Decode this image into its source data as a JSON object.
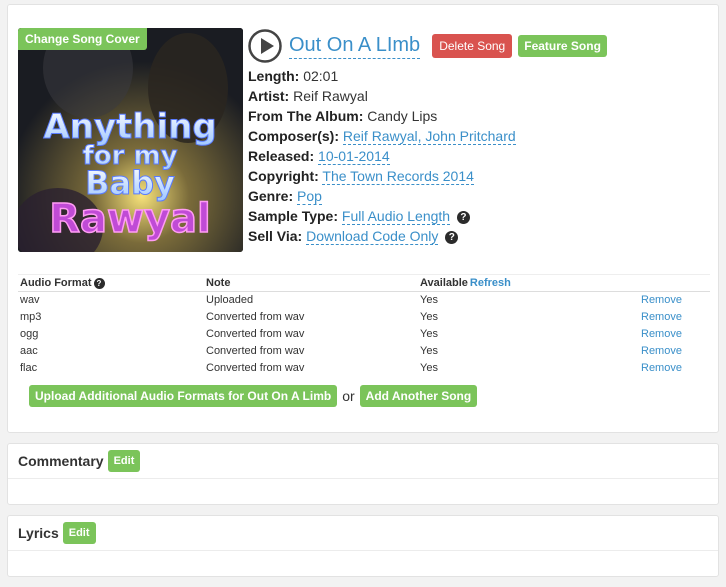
{
  "song": {
    "change_cover_label": "Change Song Cover",
    "title": "Out On A LImb",
    "delete_label": "Delete Song",
    "feature_label": "Feature Song",
    "cover_art": {
      "line1": "Anything",
      "line2": "for my",
      "line3": "Baby",
      "line4": "Rawyal"
    },
    "details": {
      "length_label": "Length:",
      "length_value": "02:01",
      "artist_label": "Artist:",
      "artist_value": "Reif Rawyal",
      "album_label": "From The Album:",
      "album_value": "Candy Lips",
      "composer_label": "Composer(s):",
      "composer_value": "Reif Rawyal, John Pritchard",
      "released_label": "Released:",
      "released_value": "10-01-2014",
      "copyright_label": "Copyright:",
      "copyright_value": "The Town Records 2014",
      "genre_label": "Genre:",
      "genre_value": "Pop",
      "sample_label": "Sample Type:",
      "sample_value": "Full Audio Length",
      "sell_label": "Sell Via:",
      "sell_value": "Download Code Only"
    }
  },
  "formats": {
    "headers": {
      "format": "Audio Format",
      "note": "Note",
      "available": "Available",
      "refresh": "Refresh"
    },
    "rows": [
      {
        "format": "wav",
        "note": "Uploaded",
        "available": "Yes",
        "action": "Remove"
      },
      {
        "format": "mp3",
        "note": "Converted from wav",
        "available": "Yes",
        "action": "Remove"
      },
      {
        "format": "ogg",
        "note": "Converted from wav",
        "available": "Yes",
        "action": "Remove"
      },
      {
        "format": "aac",
        "note": "Converted from wav",
        "available": "Yes",
        "action": "Remove"
      },
      {
        "format": "flac",
        "note": "Converted from wav",
        "available": "Yes",
        "action": "Remove"
      }
    ],
    "upload_label": "Upload Additional Audio Formats for Out On A Limb",
    "or_text": "or",
    "add_song_label": "Add Another Song"
  },
  "commentary": {
    "title": "Commentary",
    "edit_label": "Edit"
  },
  "lyrics": {
    "title": "Lyrics",
    "edit_label": "Edit"
  },
  "icons": {
    "play": "play-icon",
    "help": "question-icon"
  },
  "colors": {
    "accent": "#3a8fc9",
    "green": "#7bc45a",
    "red": "#d9534f"
  }
}
